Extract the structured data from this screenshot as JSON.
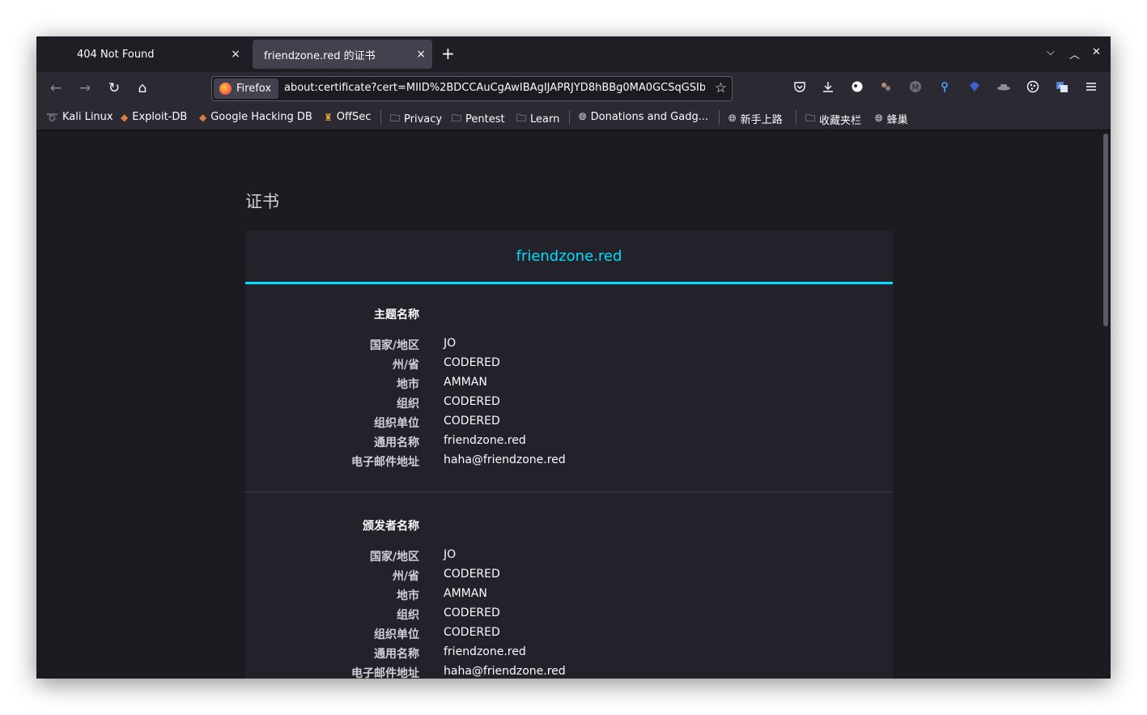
{
  "tabs": [
    {
      "title": "404 Not Found",
      "close": "×"
    },
    {
      "title": "friendzone.red 的证书",
      "close": "×"
    }
  ],
  "newtab": "+",
  "window_controls": {
    "collapse": "⌵",
    "maximize": "︿",
    "close": "✕"
  },
  "nav": {
    "back": "←",
    "forward": "→",
    "reload": "↻",
    "home": "⌂"
  },
  "urlbar": {
    "identity_label": "Firefox",
    "url": "about:certificate?cert=MIID%2BDCCAuCgAwIBAgIJAPRJYD8hBBg0MA0GCSqGSIb",
    "star": "☆"
  },
  "toolbar_icons": [
    "pocket-icon",
    "download-icon",
    "extension-icon",
    "cookie-extension-icon",
    "metamask-icon",
    "pin-icon",
    "shield-icon",
    "hat-icon",
    "puzzle-icon",
    "translate-icon",
    "menu-icon"
  ],
  "bookmarks": [
    {
      "label": "Kali Linux",
      "icon": "kali-icon"
    },
    {
      "label": "Exploit-DB",
      "icon": "exploitdb-icon"
    },
    {
      "label": "Google Hacking DB",
      "icon": "ghdb-icon"
    },
    {
      "label": "OffSec",
      "icon": "offsec-icon"
    },
    {
      "label": "Privacy",
      "icon": "folder-icon"
    },
    {
      "label": "Pentest",
      "icon": "folder-icon"
    },
    {
      "label": "Learn",
      "icon": "folder-icon"
    },
    {
      "label": "Donations and Gadg...",
      "icon": "globe-icon"
    },
    {
      "label": "新手上路",
      "icon": "globe-icon"
    },
    {
      "label": "收藏夹栏",
      "icon": "folder-icon"
    },
    {
      "label": "蜂巢",
      "icon": "globe-icon"
    }
  ],
  "page": {
    "title": "证书",
    "cert_tab": "friendzone.red",
    "subject": {
      "heading": "主题名称",
      "rows": [
        {
          "key": "国家/地区",
          "value": "JO"
        },
        {
          "key": "州/省",
          "value": "CODERED"
        },
        {
          "key": "地市",
          "value": "AMMAN"
        },
        {
          "key": "组织",
          "value": "CODERED"
        },
        {
          "key": "组织单位",
          "value": "CODERED"
        },
        {
          "key": "通用名称",
          "value": "friendzone.red"
        },
        {
          "key": "电子邮件地址",
          "value": "haha@friendzone.red"
        }
      ]
    },
    "issuer": {
      "heading": "颁发者名称",
      "rows": [
        {
          "key": "国家/地区",
          "value": "JO"
        },
        {
          "key": "州/省",
          "value": "CODERED"
        },
        {
          "key": "地市",
          "value": "AMMAN"
        },
        {
          "key": "组织",
          "value": "CODERED"
        },
        {
          "key": "组织单位",
          "value": "CODERED"
        },
        {
          "key": "通用名称",
          "value": "friendzone.red"
        },
        {
          "key": "电子邮件地址",
          "value": "haha@friendzone.red"
        }
      ]
    }
  },
  "colors": {
    "accent": "#00ddff",
    "content_bg": "#1c1b22",
    "card_bg": "#23222b",
    "toolbar_bg": "#2b2a33"
  }
}
